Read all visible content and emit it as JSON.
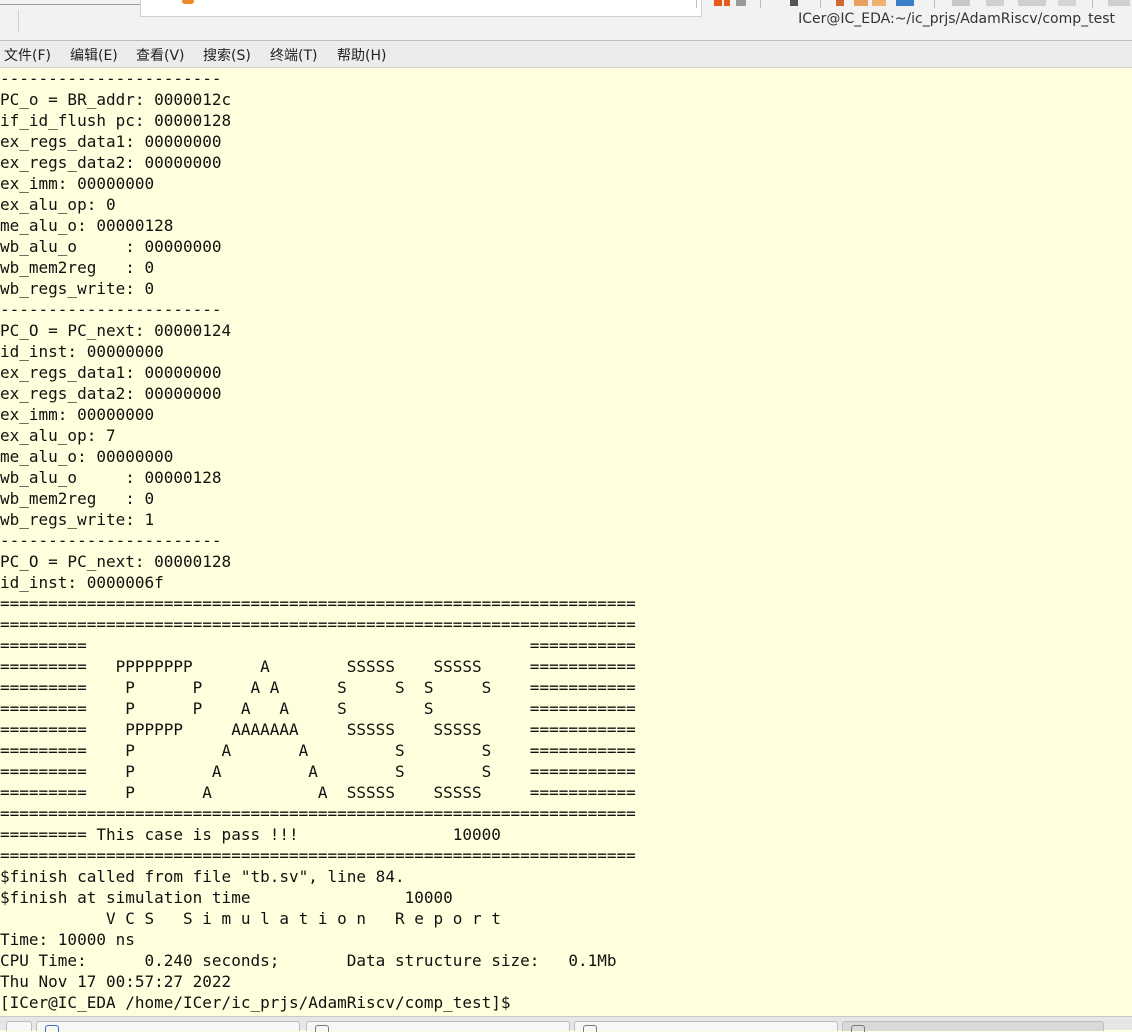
{
  "window": {
    "title": "ICer@IC_EDA:~/ic_prjs/AdamRiscv/comp_test"
  },
  "menu": {
    "items": [
      "文件(F)",
      "编辑(E)",
      "查看(V)",
      "搜索(S)",
      "终端(T)",
      "帮助(H)"
    ]
  },
  "terminal": {
    "lines": [
      "-----------------------",
      "PC_o = BR_addr: 0000012c",
      "if_id_flush pc: 00000128",
      "ex_regs_data1: 00000000",
      "ex_regs_data2: 00000000",
      "ex_imm: 00000000",
      "ex_alu_op: 0",
      "me_alu_o: 00000128",
      "wb_alu_o     : 00000000",
      "wb_mem2reg   : 0",
      "wb_regs_write: 0",
      "-----------------------",
      "PC_O = PC_next: 00000124",
      "id_inst: 00000000",
      "ex_regs_data1: 00000000",
      "ex_regs_data2: 00000000",
      "ex_imm: 00000000",
      "ex_alu_op: 7",
      "me_alu_o: 00000000",
      "wb_alu_o     : 00000128",
      "wb_mem2reg   : 0",
      "wb_regs_write: 1",
      "-----------------------",
      "PC_O = PC_next: 00000128",
      "id_inst: 0000006f",
      "==================================================================",
      "==================================================================",
      "=========                                              ===========",
      "=========   PPPPPPPP       A        SSSSS    SSSSS     ===========",
      "=========    P      P     A A      S     S  S     S    ===========",
      "=========    P      P    A   A     S        S          ===========",
      "=========    PPPPPP     AAAAAAA     SSSSS    SSSSS     ===========",
      "=========    P         A       A         S        S    ===========",
      "=========    P        A         A        S        S    ===========",
      "=========    P       A           A  SSSSS    SSSSS     ===========",
      "==================================================================",
      "========= This case is pass !!!                10000",
      "==================================================================",
      "$finish called from file \"tb.sv\", line 84.",
      "$finish at simulation time                10000",
      "           V C S   S i m u l a t i o n   R e p o r t",
      "Time: 10000 ns",
      "CPU Time:      0.240 seconds;       Data structure size:   0.1Mb",
      "Thu Nov 17 00:57:27 2022",
      "[ICer@IC_EDA /home/ICer/ic_prjs/AdamRiscv/comp_test]$"
    ]
  }
}
